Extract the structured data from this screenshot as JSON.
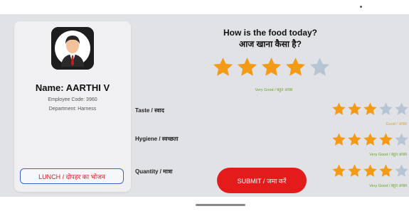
{
  "profile": {
    "name": "Name: AARTHI V",
    "employee_code": "Employee Code: 3960",
    "department": "Department: Harness",
    "meal_button": "LUNCH / दोपहर का भोजन"
  },
  "question": {
    "line1": "How is the food today?",
    "line2": "आज खाना कैसा है?"
  },
  "overall_rating": {
    "value": 4,
    "max": 5,
    "caption": "Very Good / बहुत अच्छा"
  },
  "criteria": [
    {
      "label": "Taste / स्वाद",
      "value": 3,
      "max": 5,
      "caption": "Good / अच्छा"
    },
    {
      "label": "Hygiene / स्वच्छता",
      "value": 4,
      "max": 5,
      "caption": "Very Good / बहुत अच्छा"
    },
    {
      "label": "Quantity / मात्रा",
      "value": 4,
      "max": 5,
      "caption": "Very Good / बहुत अच्छा"
    }
  ],
  "submit_label": "SUBMIT / जमा करें",
  "colors": {
    "star_filled": "#f39a17",
    "star_empty": "#b7c4d3",
    "submit_bg": "#e31b1b",
    "meal_text": "#d21f1f",
    "caption_very_good": "#6aa22a",
    "caption_good": "#e4a11c"
  },
  "icons": {
    "avatar": "person-avatar-icon",
    "star": "star-icon"
  }
}
